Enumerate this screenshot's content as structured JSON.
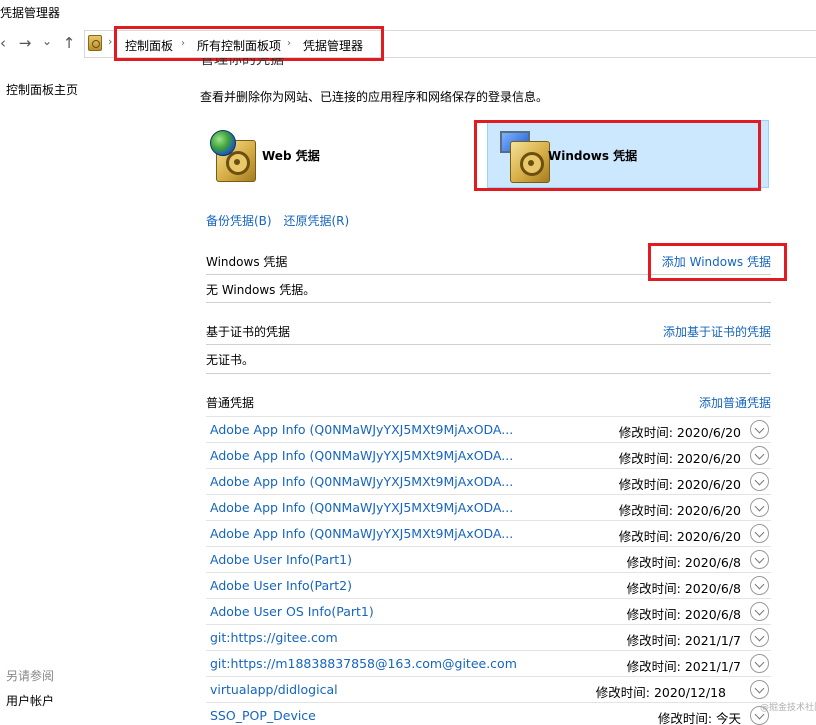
{
  "window": {
    "title": "凭据管理器"
  },
  "nav": {
    "back_glyph": "‹",
    "forward_glyph": "→",
    "dropdown_glyph": "⌄",
    "up_glyph": "↑",
    "breadcrumb": [
      "控制面板",
      "所有控制面板项",
      "凭据管理器"
    ],
    "separator": "›"
  },
  "sidebar": {
    "home_link": "控制面板主页",
    "see_also_label": "另请参阅",
    "see_also_items": [
      "用户帐户"
    ]
  },
  "main": {
    "heading": "管理你的凭据",
    "description": "查看并删除你为网站、已连接的应用程序和网络保存的登录信息。",
    "web_credentials_label": "Web 凭据",
    "windows_credentials_label": "Windows 凭据",
    "backup_link": "备份凭据(B)",
    "restore_link": "还原凭据(R)"
  },
  "sections": {
    "windows": {
      "title": "Windows 凭据",
      "add_link": "添加 Windows 凭据",
      "empty_text": "无 Windows 凭据。"
    },
    "certificate": {
      "title": "基于证书的凭据",
      "add_link": "添加基于证书的凭据",
      "empty_text": "无证书。"
    },
    "generic": {
      "title": "普通凭据",
      "add_link": "添加普通凭据",
      "items": [
        {
          "name": "Adobe App Info (Q0NMaWJyYXJ5MXt9MjAxODA...",
          "modified": "修改时间:  2020/6/20"
        },
        {
          "name": "Adobe App Info (Q0NMaWJyYXJ5MXt9MjAxODA...",
          "modified": "修改时间:  2020/6/20"
        },
        {
          "name": "Adobe App Info (Q0NMaWJyYXJ5MXt9MjAxODA...",
          "modified": "修改时间:  2020/6/20"
        },
        {
          "name": "Adobe App Info (Q0NMaWJyYXJ5MXt9MjAxODA...",
          "modified": "修改时间:  2020/6/20"
        },
        {
          "name": "Adobe App Info (Q0NMaWJyYXJ5MXt9MjAxODA...",
          "modified": "修改时间:  2020/6/20"
        },
        {
          "name": "Adobe User Info(Part1)",
          "modified": "修改时间:  2020/6/8"
        },
        {
          "name": "Adobe User Info(Part2)",
          "modified": "修改时间:  2020/6/8"
        },
        {
          "name": "Adobe User OS Info(Part1)",
          "modified": "修改时间:  2020/6/8"
        },
        {
          "name": "git:https://gitee.com",
          "modified": "修改时间:  2021/1/7"
        },
        {
          "name": "git:https://m18838837858@163.com@gitee.com",
          "modified": "修改时间:  2021/1/7"
        },
        {
          "name": "virtualapp/didlogical",
          "modified": "修改时间:  2020/12/18"
        },
        {
          "name": "SSO_POP_Device",
          "modified": "修改时间:  今天"
        }
      ]
    }
  },
  "watermark": "@掘金技术社区",
  "colors": {
    "link": "#1565c0",
    "highlight_red": "#e11b22",
    "selected_tile": "#cce8ff"
  }
}
